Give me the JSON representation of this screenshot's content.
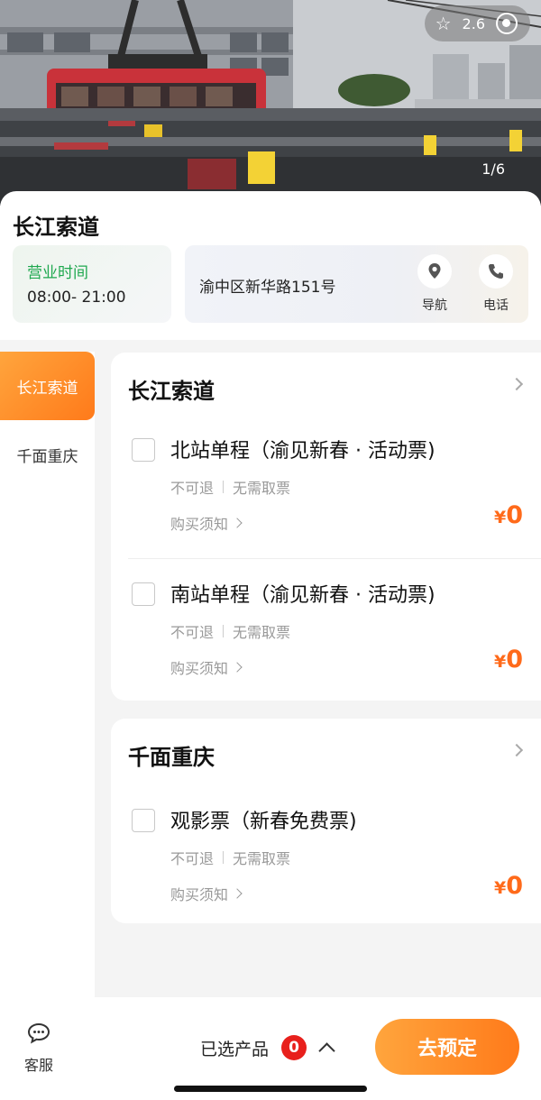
{
  "hero": {
    "rating": "2.6",
    "counter": "1/6"
  },
  "venue": {
    "title": "长江索道",
    "hours_label": "营业时间",
    "hours_value": "08:00- 21:00",
    "address": "渝中区新华路151号",
    "nav_label": "导航",
    "phone_label": "电话"
  },
  "sidebar": {
    "items": [
      {
        "label": "长江索道",
        "active": true
      },
      {
        "label": "千面重庆",
        "active": false
      }
    ]
  },
  "sections": [
    {
      "title": "长江索道",
      "products": [
        {
          "name": "北站单程（渝见新春 · 活动票)",
          "tag1": "不可退",
          "tag2": "无需取票",
          "notice": "购买须知",
          "currency": "¥",
          "price": "0"
        },
        {
          "name": "南站单程（渝见新春 · 活动票)",
          "tag1": "不可退",
          "tag2": "无需取票",
          "notice": "购买须知",
          "currency": "¥",
          "price": "0"
        }
      ]
    },
    {
      "title": "千面重庆",
      "products": [
        {
          "name": "观影票（新春免费票)",
          "tag1": "不可退",
          "tag2": "无需取票",
          "notice": "购买须知",
          "currency": "¥",
          "price": "0"
        }
      ]
    }
  ],
  "bottom": {
    "service_label": "客服",
    "selected_label": "已选产品",
    "selected_count": "0",
    "book_label": "去预定"
  },
  "colors": {
    "accent": "#ff7a1a",
    "green": "#1fa84f",
    "badge": "#e8201c"
  }
}
